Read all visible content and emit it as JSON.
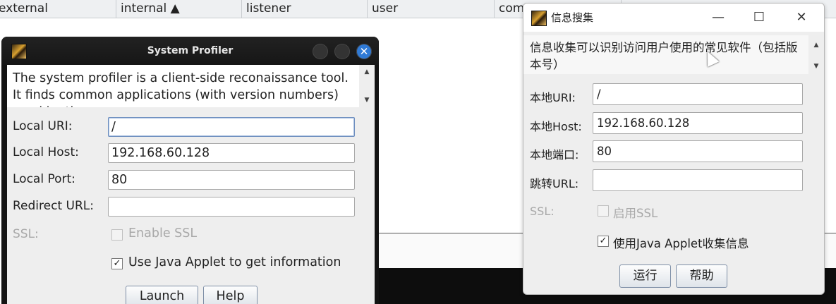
{
  "table": {
    "columns": [
      {
        "label": "external"
      },
      {
        "label": "internal ▲"
      },
      {
        "label": "listener"
      },
      {
        "label": "user"
      },
      {
        "label": "com"
      }
    ]
  },
  "profiler_en": {
    "title": "System Profiler",
    "close_glyph": "✕",
    "description": "The system profiler is a client-side reconaissance tool. It finds common applications (with version numbers) used by the user.",
    "fields": {
      "local_uri": {
        "label": "Local URI:",
        "value": "/"
      },
      "local_host": {
        "label": "Local Host:",
        "value": "192.168.60.128"
      },
      "local_port": {
        "label": "Local Port:",
        "value": "80"
      },
      "redirect_url": {
        "label": "Redirect URL:",
        "value": ""
      }
    },
    "ssl": {
      "label": "SSL:",
      "checkbox_label": "Enable SSL",
      "checked": false,
      "enabled": false
    },
    "java_applet": {
      "label": "Use Java Applet to get information",
      "checked": true
    },
    "buttons": {
      "launch": "Launch",
      "help": "Help"
    }
  },
  "profiler_cn": {
    "title": "信息搜集",
    "controls": {
      "minimize": "—",
      "maximize": "☐",
      "close": "✕"
    },
    "description": "信息收集可以识别访问用户使用的常见软件（包括版本号）",
    "fields": {
      "local_uri": {
        "label": "本地URI:",
        "value": "/"
      },
      "local_host": {
        "label": "本地Host:",
        "value": "192.168.60.128"
      },
      "local_port": {
        "label": "本地端口:",
        "value": "80"
      },
      "redirect_url": {
        "label": "跳转URL:",
        "value": ""
      }
    },
    "ssl": {
      "label": "SSL:",
      "checkbox_label": "启用SSL",
      "checked": false,
      "enabled": false
    },
    "java_applet": {
      "label": "使用Java Applet收集信息",
      "checked": true
    },
    "buttons": {
      "run": "运行",
      "help": "帮助"
    }
  },
  "icons": {
    "app_icon": "cobalt-strike-icon",
    "check": "✓",
    "arrow_up": "▲",
    "arrow_down": "▼"
  }
}
